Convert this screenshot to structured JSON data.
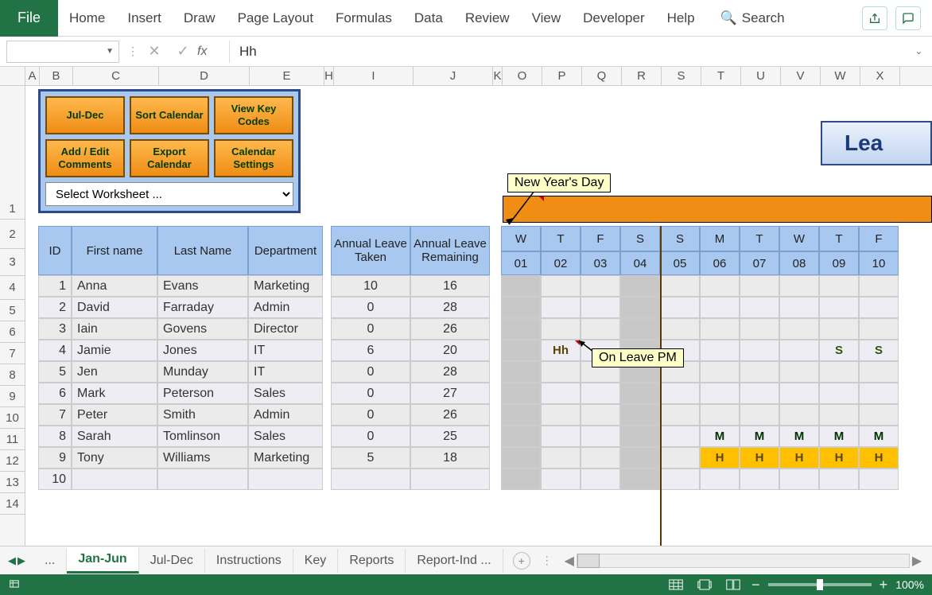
{
  "ribbon": {
    "file": "File",
    "tabs": [
      "Home",
      "Insert",
      "Draw",
      "Page Layout",
      "Formulas",
      "Data",
      "Review",
      "View",
      "Developer",
      "Help"
    ],
    "search": "Search"
  },
  "formula_bar": {
    "name_box": "",
    "fx": "fx",
    "value": "Hh"
  },
  "columns": {
    "labels": [
      "A",
      "B",
      "C",
      "D",
      "E",
      "H",
      "I",
      "J",
      "K",
      "O",
      "P",
      "Q",
      "R",
      "S",
      "T",
      "U",
      "V",
      "W",
      "X"
    ],
    "widths": [
      18,
      42,
      108,
      114,
      94,
      12,
      100,
      100,
      12,
      50,
      50,
      50,
      50,
      50,
      50,
      50,
      50,
      50,
      50
    ]
  },
  "row_headers": [
    "1",
    "2",
    "3",
    "4",
    "5",
    "6",
    "7",
    "8",
    "9",
    "10",
    "11",
    "12",
    "13",
    "14"
  ],
  "control_panel": {
    "row1": [
      "Jul-Dec",
      "Sort Calendar",
      "View Key Codes"
    ],
    "row2": [
      "Add / Edit Comments",
      "Export Calendar",
      "Calendar Settings"
    ],
    "select_placeholder": "Select Worksheet ..."
  },
  "title_banner": "Lea",
  "callouts": {
    "new_year": "New Year's Day",
    "on_leave": "On Leave PM"
  },
  "table": {
    "headers": {
      "id": "ID",
      "first": "First name",
      "last": "Last Name",
      "dept": "Department",
      "taken": "Annual Leave Taken",
      "remain": "Annual Leave Remaining"
    },
    "day_letters": [
      "W",
      "T",
      "F",
      "S",
      "S",
      "M",
      "T",
      "W",
      "T",
      "F"
    ],
    "day_nums": [
      "01",
      "02",
      "03",
      "04",
      "05",
      "06",
      "07",
      "08",
      "09",
      "10"
    ],
    "rows": [
      {
        "id": "1",
        "first": "Anna",
        "last": "Evans",
        "dept": "Marketing",
        "taken": "10",
        "remain": "16",
        "days": [
          "",
          "",
          "",
          "",
          "",
          "",
          "",
          "",
          "",
          ""
        ]
      },
      {
        "id": "2",
        "first": "David",
        "last": "Farraday",
        "dept": "Admin",
        "taken": "0",
        "remain": "28",
        "days": [
          "",
          "",
          "",
          "",
          "",
          "",
          "",
          "",
          "",
          ""
        ]
      },
      {
        "id": "3",
        "first": "Iain",
        "last": "Govens",
        "dept": "Director",
        "taken": "0",
        "remain": "26",
        "days": [
          "",
          "",
          "",
          "",
          "",
          "",
          "",
          "",
          "",
          ""
        ]
      },
      {
        "id": "4",
        "first": "Jamie",
        "last": "Jones",
        "dept": "IT",
        "taken": "6",
        "remain": "20",
        "days": [
          "",
          "Hh",
          "",
          "",
          "",
          "",
          "",
          "",
          "S",
          "S"
        ]
      },
      {
        "id": "5",
        "first": "Jen",
        "last": "Munday",
        "dept": "IT",
        "taken": "0",
        "remain": "28",
        "days": [
          "",
          "",
          "",
          "",
          "",
          "",
          "",
          "",
          "",
          ""
        ]
      },
      {
        "id": "6",
        "first": "Mark",
        "last": "Peterson",
        "dept": "Sales",
        "taken": "0",
        "remain": "27",
        "days": [
          "",
          "",
          "",
          "",
          "",
          "",
          "",
          "",
          "",
          ""
        ]
      },
      {
        "id": "7",
        "first": "Peter",
        "last": "Smith",
        "dept": "Admin",
        "taken": "0",
        "remain": "26",
        "days": [
          "",
          "",
          "",
          "",
          "",
          "",
          "",
          "",
          "",
          ""
        ]
      },
      {
        "id": "8",
        "first": "Sarah",
        "last": "Tomlinson",
        "dept": "Sales",
        "taken": "0",
        "remain": "25",
        "days": [
          "",
          "",
          "",
          "",
          "",
          "M",
          "M",
          "M",
          "M",
          "M"
        ]
      },
      {
        "id": "9",
        "first": "Tony",
        "last": "Williams",
        "dept": "Marketing",
        "taken": "5",
        "remain": "18",
        "days": [
          "",
          "",
          "",
          "",
          "",
          "H",
          "H",
          "H",
          "H",
          "H"
        ]
      },
      {
        "id": "10",
        "first": "",
        "last": "",
        "dept": "",
        "taken": "",
        "remain": "",
        "days": [
          "",
          "",
          "",
          "",
          "",
          "",
          "",
          "",
          "",
          ""
        ]
      }
    ]
  },
  "sheet_tabs": {
    "overflow": "...",
    "tabs": [
      "Jan-Jun",
      "Jul-Dec",
      "Instructions",
      "Key",
      "Reports",
      "Report-Ind  ..."
    ],
    "active": 0
  },
  "status": {
    "zoom": "100%"
  }
}
